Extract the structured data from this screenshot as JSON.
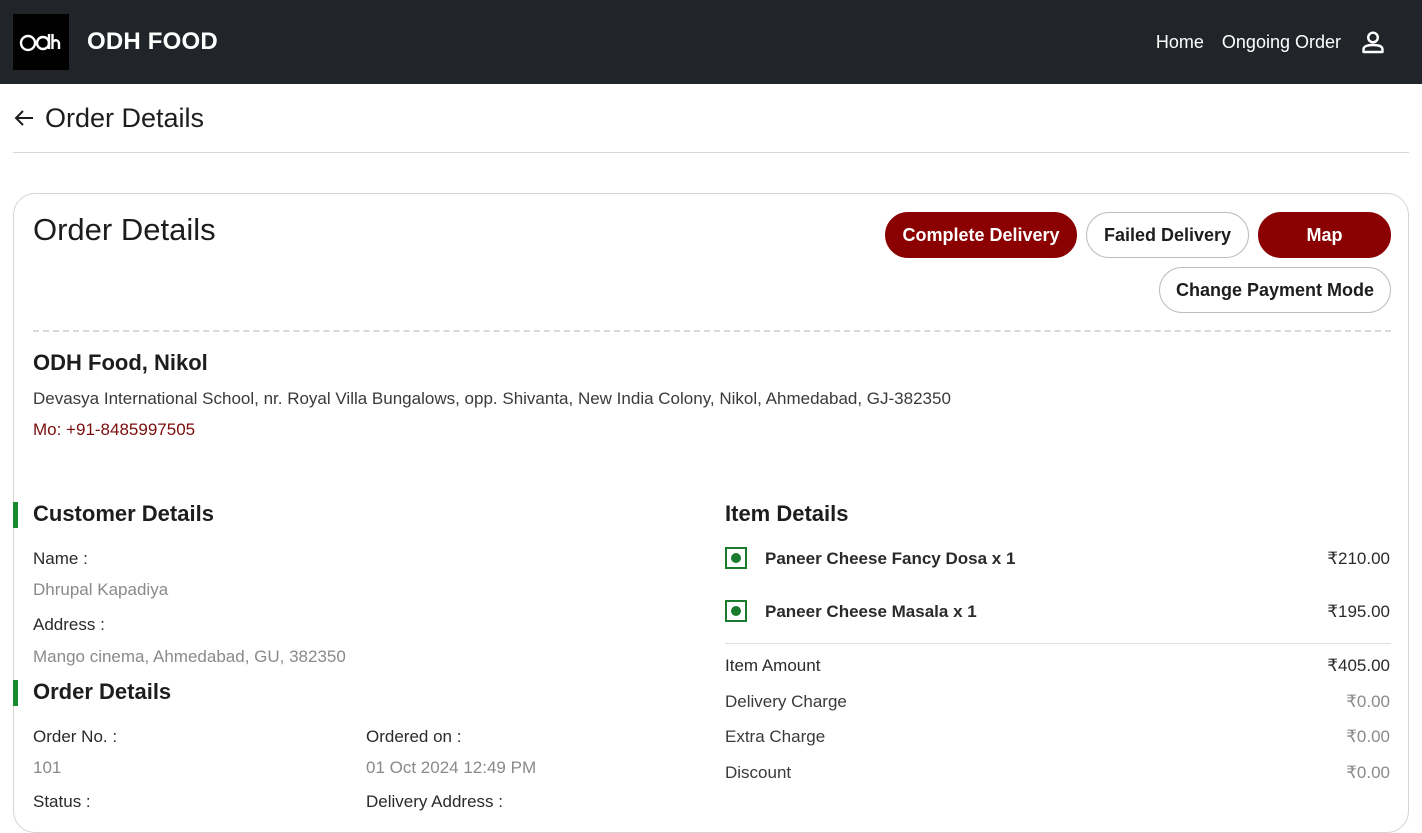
{
  "header": {
    "logo_text": "odh",
    "brand": "ODH FOOD",
    "nav": [
      "Home",
      "Ongoing Order"
    ],
    "bg_color": "#212529"
  },
  "page": {
    "title": "Order Details"
  },
  "card": {
    "title": "Order Details",
    "buttons": {
      "complete": "Complete Delivery",
      "failed": "Failed Delivery",
      "map": "Map",
      "payment": "Change Payment Mode"
    },
    "accent_color": "#8b0000"
  },
  "restaurant": {
    "name": "ODH Food, Nikol",
    "address": "Devasya International School, nr. Royal Villa Bungalows, opp. Shivanta, New India Colony, Nikol, Ahmedabad, GJ-382350",
    "phone": "Mo: +91-8485997505"
  },
  "customer": {
    "section_title": "Customer Details",
    "name_label": "Name :",
    "name": "Dhrupal Kapadiya",
    "address_label": "Address :",
    "address": "Mango cinema, Ahmedabad, GU, 382350"
  },
  "order": {
    "section_title": "Order Details",
    "order_no_label": "Order No. :",
    "order_no": "101",
    "ordered_on_label": "Ordered on :",
    "ordered_on": "01 Oct 2024 12:49 PM",
    "status_label": "Status :",
    "delivery_address_label": "Delivery Address :"
  },
  "items": {
    "section_title": "Item Details",
    "list": [
      {
        "name": "Paneer Cheese Fancy Dosa",
        "qty": "x 1",
        "price": "₹210.00"
      },
      {
        "name": "Paneer Cheese Masala",
        "qty": "x 1",
        "price": "₹195.00"
      }
    ],
    "summary": [
      {
        "label": "Item Amount",
        "value": "₹405.00"
      },
      {
        "label": "Delivery Charge",
        "value": "₹0.00"
      },
      {
        "label": "Extra Charge",
        "value": "₹0.00"
      },
      {
        "label": "Discount",
        "value": "₹0.00"
      }
    ],
    "veg_color": "#1a7a2e"
  }
}
